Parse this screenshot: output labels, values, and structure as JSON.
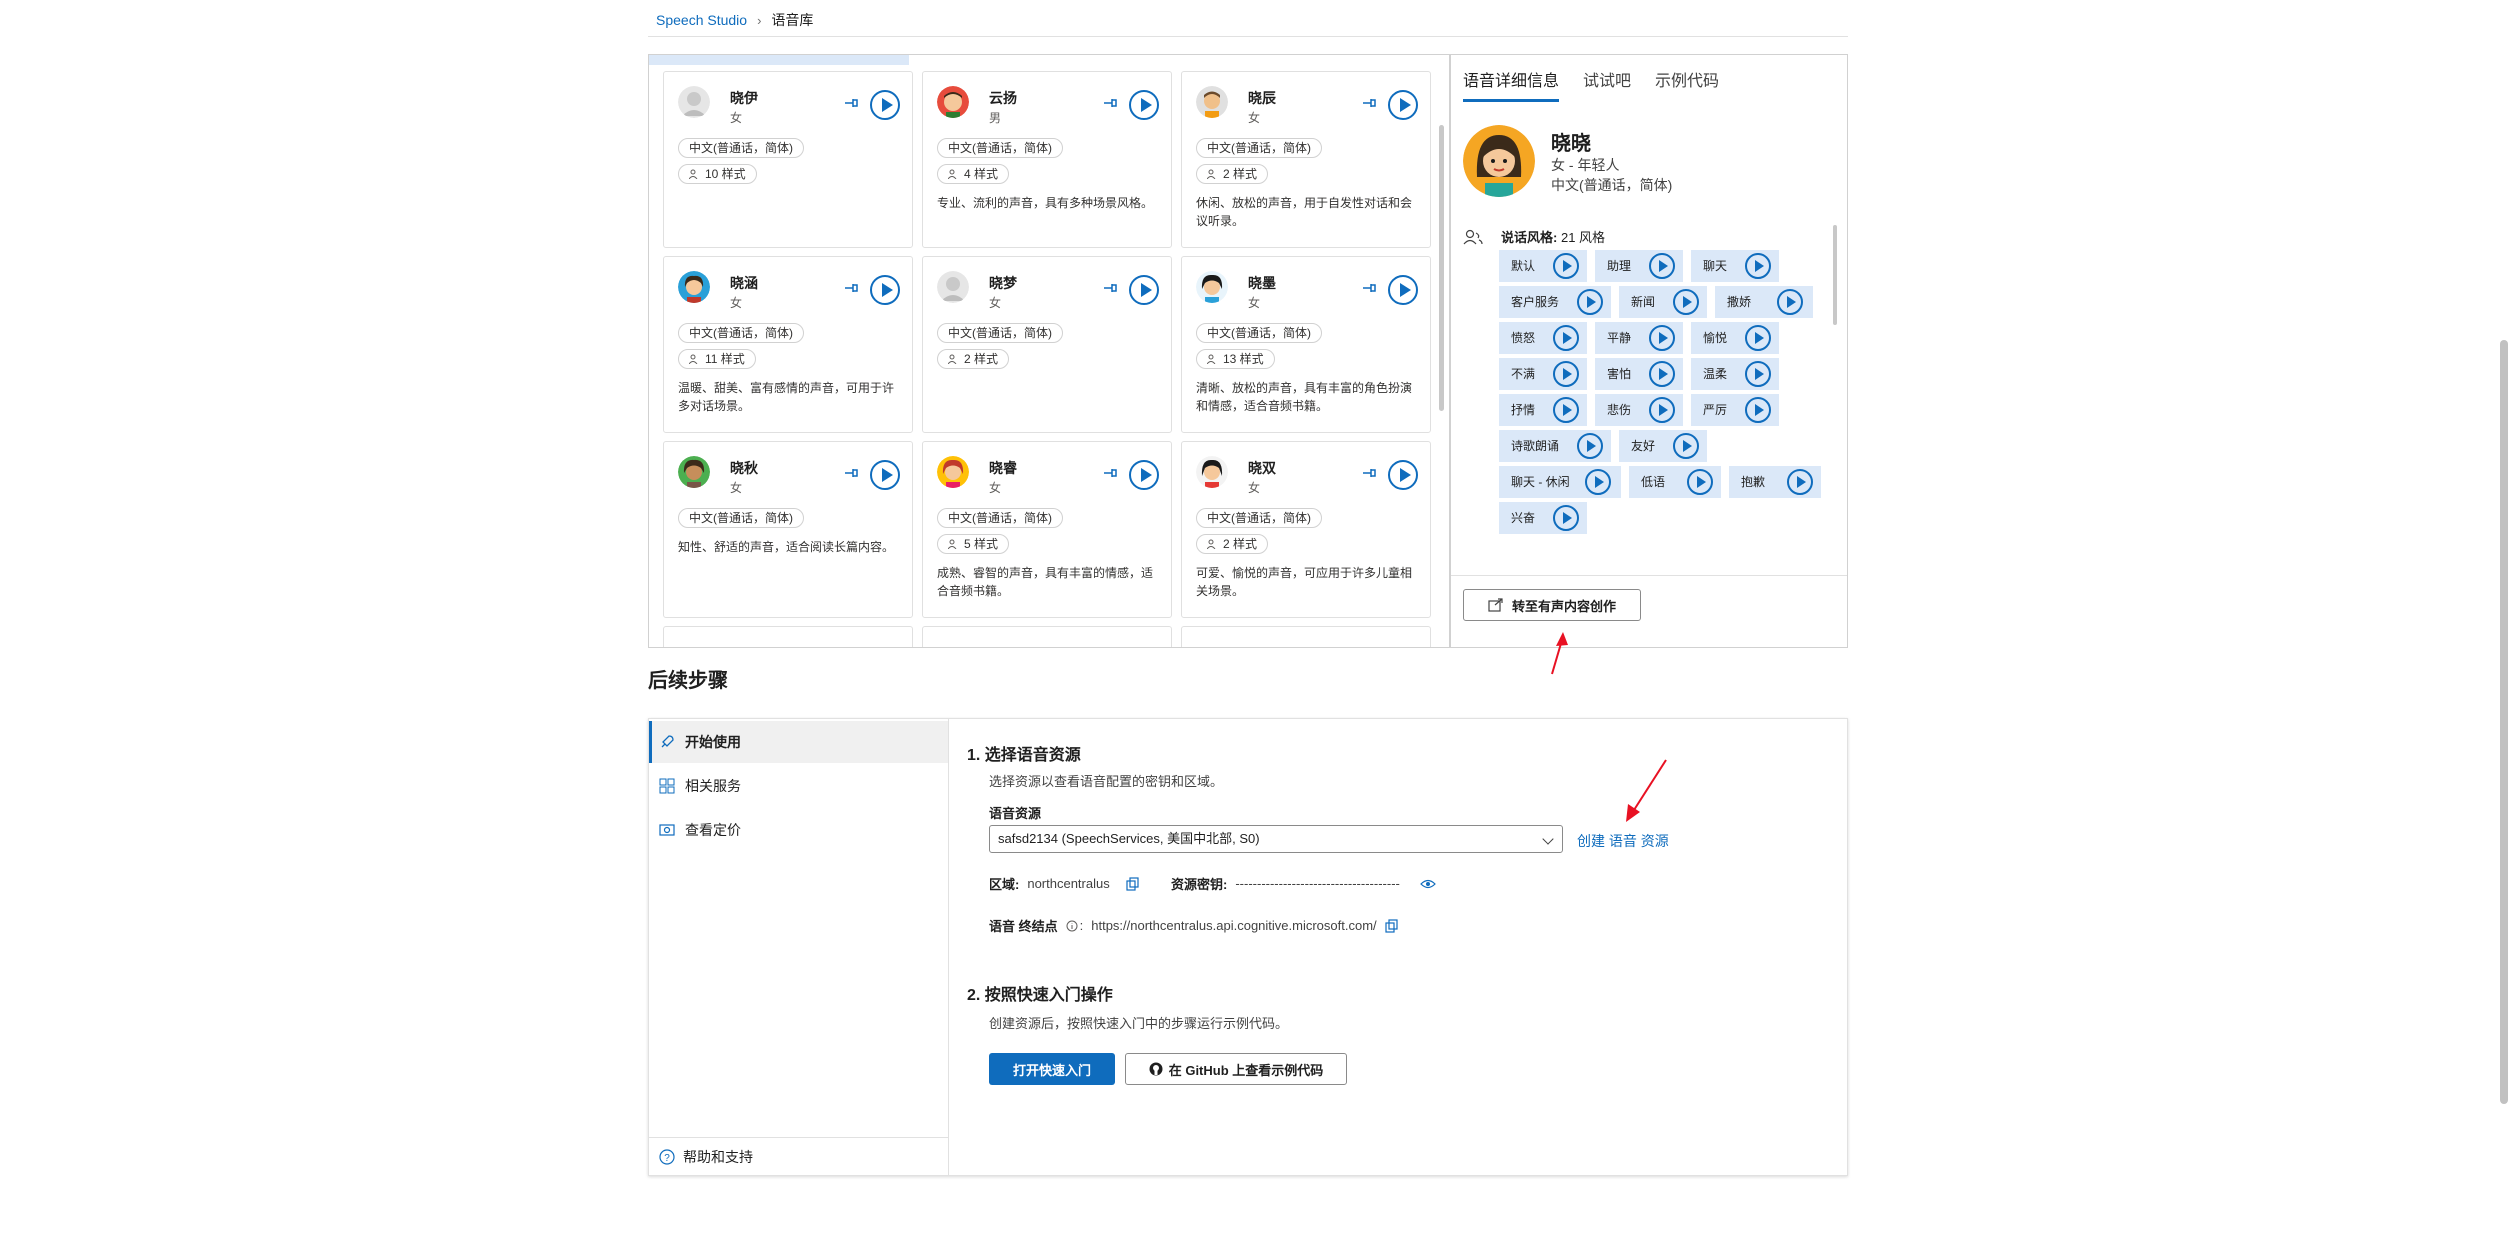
{
  "breadcrumb": {
    "root": "Speech Studio",
    "current": "语音库"
  },
  "voices": [
    {
      "name": "晓伊",
      "gender": "女",
      "lang": "中文(普通话，简体)",
      "styles": "10 样式",
      "desc": ""
    },
    {
      "name": "云扬",
      "gender": "男",
      "lang": "中文(普通话，简体)",
      "styles": "4 样式",
      "desc": "专业、流利的声音，具有多种场景风格。"
    },
    {
      "name": "晓辰",
      "gender": "女",
      "lang": "中文(普通话，简体)",
      "styles": "2 样式",
      "desc": "休闲、放松的声音，用于自发性对话和会议听录。"
    },
    {
      "name": "晓涵",
      "gender": "女",
      "lang": "中文(普通话，简体)",
      "styles": "11 样式",
      "desc": "温暖、甜美、富有感情的声音，可用于许多对话场景。"
    },
    {
      "name": "晓梦",
      "gender": "女",
      "lang": "中文(普通话，简体)",
      "styles": "2 样式",
      "desc": ""
    },
    {
      "name": "晓墨",
      "gender": "女",
      "lang": "中文(普通话，简体)",
      "styles": "13 样式",
      "desc": "清晰、放松的声音，具有丰富的角色扮演和情感，适合音频书籍。"
    },
    {
      "name": "晓秋",
      "gender": "女",
      "lang": "中文(普通话，简体)",
      "styles": "",
      "desc": "知性、舒适的声音，适合阅读长篇内容。"
    },
    {
      "name": "晓睿",
      "gender": "女",
      "lang": "中文(普通话，简体)",
      "styles": "5 样式",
      "desc": "成熟、睿智的声音，具有丰富的情感，适合音频书籍。"
    },
    {
      "name": "晓双",
      "gender": "女",
      "lang": "中文(普通话，简体)",
      "styles": "2 样式",
      "desc": "可爱、愉悦的声音，可应用于许多儿童相关场景。"
    }
  ],
  "detail": {
    "tabs": [
      "语音详细信息",
      "试试吧",
      "示例代码"
    ],
    "name": "晓晓",
    "sub": "女 - 年轻人",
    "lang": "中文(普通话，简体)",
    "style_label": "说话风格:",
    "style_count": "21 风格",
    "styles": [
      "默认",
      "助理",
      "聊天",
      "客户服务",
      "新闻",
      "撒娇",
      "愤怒",
      "平静",
      "愉悦",
      "不满",
      "害怕",
      "温柔",
      "抒情",
      "悲伤",
      "严厉",
      "诗歌朗诵",
      "友好",
      "聊天 - 休闲",
      "低语",
      "抱歉",
      "兴奋"
    ],
    "convert_label": "转至有声内容创作"
  },
  "next_steps": {
    "title": "后续步骤",
    "nav": [
      "开始使用",
      "相关服务",
      "查看定价"
    ],
    "help": "帮助和支持",
    "step1_title": "1. 选择语音资源",
    "step1_desc": "选择资源以查看语音配置的密钥和区域。",
    "resource_label": "语音资源",
    "resource_value": "safsd2134 (SpeechServices, 美国中北部, S0)",
    "create_link": "创建 语音 资源",
    "region_label": "区域:",
    "region_value": "northcentralus",
    "key_label": "资源密钥:",
    "key_value": "--------------------------------------",
    "endpoint_label": "语音 终结点",
    "endpoint_value": "https://northcentralus.api.cognitive.microsoft.com/",
    "step2_title": "2. 按照快速入门操作",
    "step2_desc": "创建资源后，按照快速入门中的步骤运行示例代码。",
    "quickstart_btn": "打开快速入门",
    "github_btn": "在 GitHub 上查看示例代码"
  },
  "colors": {
    "accent": "#0f6cbd",
    "chip_bg": "#dbe8f8",
    "arrow": "#e81123"
  }
}
